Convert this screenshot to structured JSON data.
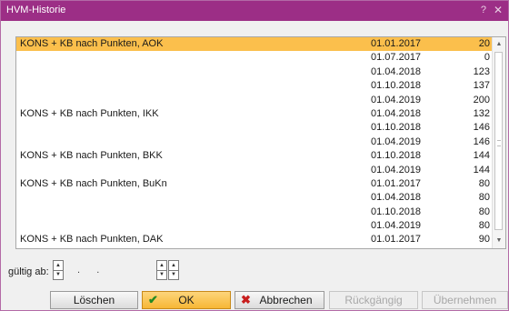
{
  "window": {
    "title": "HVM-Historie",
    "help_label": "?",
    "close_label": "✕"
  },
  "list": {
    "rows": [
      {
        "name": "KONS + KB nach Punkten, AOK",
        "date": "01.01.2017",
        "value": "20",
        "selected": true
      },
      {
        "name": "",
        "date": "01.07.2017",
        "value": "0"
      },
      {
        "name": "",
        "date": "01.04.2018",
        "value": "123"
      },
      {
        "name": "",
        "date": "01.10.2018",
        "value": "137"
      },
      {
        "name": "",
        "date": "01.04.2019",
        "value": "200"
      },
      {
        "name": "KONS + KB nach Punkten, IKK",
        "date": "01.04.2018",
        "value": "132"
      },
      {
        "name": "",
        "date": "01.10.2018",
        "value": "146"
      },
      {
        "name": "",
        "date": "01.04.2019",
        "value": "146"
      },
      {
        "name": "KONS + KB nach Punkten, BKK",
        "date": "01.10.2018",
        "value": "144"
      },
      {
        "name": "",
        "date": "01.04.2019",
        "value": "144"
      },
      {
        "name": "KONS + KB nach Punkten, BuKn",
        "date": "01.01.2017",
        "value": "80"
      },
      {
        "name": "",
        "date": "01.04.2018",
        "value": "80"
      },
      {
        "name": "",
        "date": "01.10.2018",
        "value": "80"
      },
      {
        "name": "",
        "date": "01.04.2019",
        "value": "80"
      },
      {
        "name": "KONS + KB nach Punkten, DAK",
        "date": "01.01.2017",
        "value": "90"
      }
    ]
  },
  "valid_from": {
    "label": "gültig ab:",
    "value": " .  . "
  },
  "buttons": {
    "delete": "Löschen",
    "ok": "OK",
    "cancel": "Abbrechen",
    "undo": "Rückgängig",
    "apply": "Übernehmen"
  },
  "colors": {
    "titlebar": "#9c2e86",
    "selection": "#fbbf4c",
    "ok_button": "#f7b735"
  }
}
